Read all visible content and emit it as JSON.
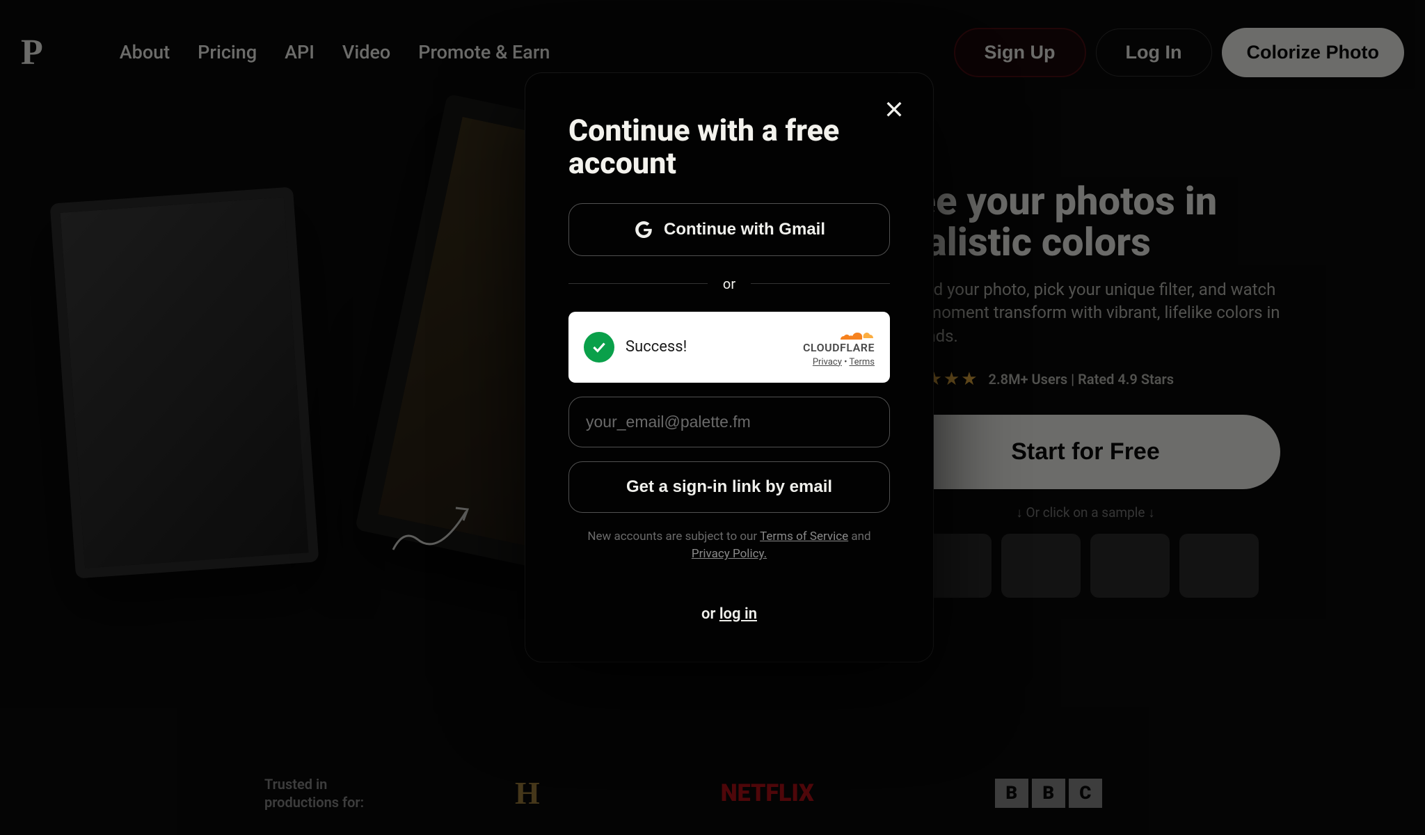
{
  "logo": "P",
  "nav": {
    "about": "About",
    "pricing": "Pricing",
    "api": "API",
    "video": "Video",
    "promote": "Promote & Earn"
  },
  "header_actions": {
    "signup": "Sign Up",
    "login": "Log In",
    "colorize": "Colorize Photo"
  },
  "hero": {
    "title": "See your photos in realistic colors",
    "subtitle": "Upload your photo, pick your unique filter, and watch your moment transform with vibrant, lifelike colors in seconds.",
    "rating_text": "2.8M+ Users | Rated 4.9 Stars",
    "start": "Start for Free",
    "sample_hint": "↓ Or click on a sample ↓"
  },
  "trusted": {
    "label": "Trusted in productions for:",
    "netflix": "NETFLIX",
    "history": "H"
  },
  "modal": {
    "title": "Continue with a free account",
    "gmail": "Continue with Gmail",
    "or": "or",
    "cf_success": "Success!",
    "cf_brand": "CLOUDFLARE",
    "cf_privacy": "Privacy",
    "cf_terms": "Terms",
    "email_placeholder": "your_email@palette.fm",
    "email_link": "Get a sign-in link by email",
    "terms_prefix": "New accounts are subject to our ",
    "terms_tos": "Terms of Service",
    "terms_and": " and ",
    "terms_privacy": "Privacy Policy.",
    "login_or": "or ",
    "login_link": "log in"
  }
}
